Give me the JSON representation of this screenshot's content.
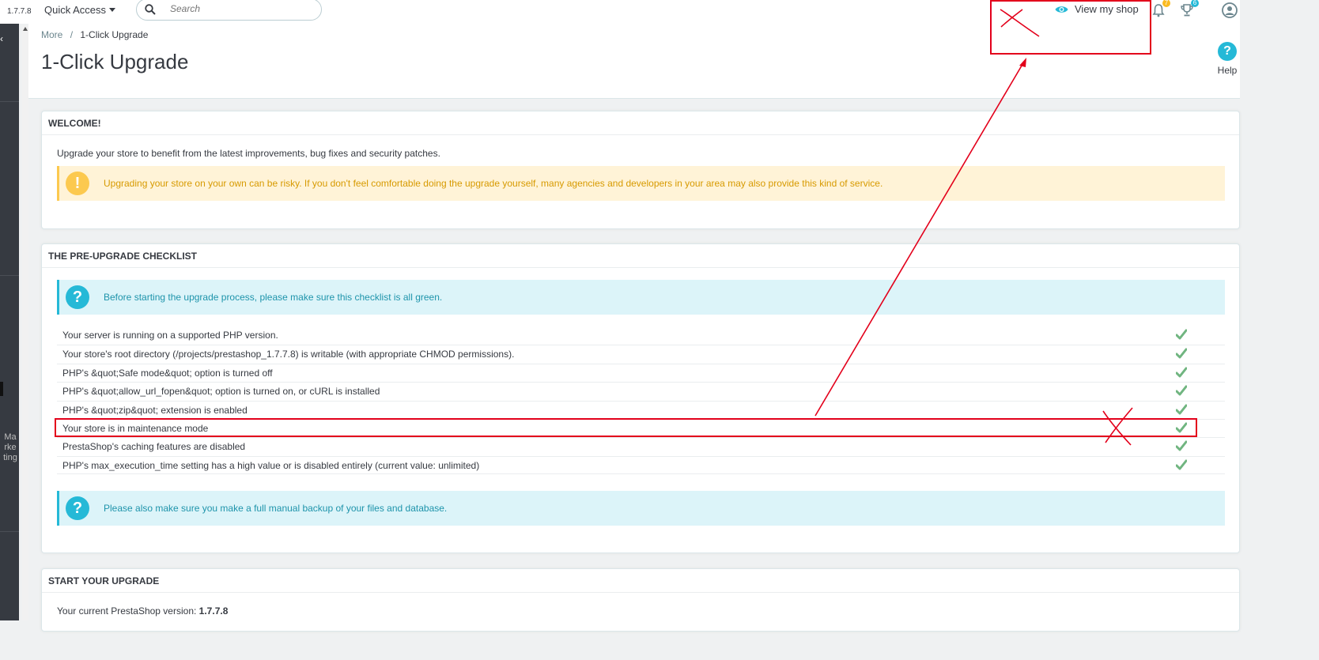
{
  "header": {
    "version": "1.7.7.8",
    "quick_access": "Quick Access",
    "search_placeholder": "Search",
    "view_shop": "View my shop",
    "notif_count": "7",
    "trophy_count": "6"
  },
  "sidebar": {
    "label": "Marketing"
  },
  "breadcrumb": {
    "parent": "More",
    "sep": "/",
    "current": "1-Click Upgrade"
  },
  "page": {
    "title": "1-Click Upgrade",
    "help": "Help"
  },
  "welcome": {
    "heading": "WELCOME!",
    "intro": "Upgrade your store to benefit from the latest improvements, bug fixes and security patches.",
    "warning": "Upgrading your store on your own can be risky. If you don't feel comfortable doing the upgrade yourself, many agencies and developers in your area may also provide this kind of service."
  },
  "checklist": {
    "heading": "THE PRE-UPGRADE CHECKLIST",
    "info": "Before starting the upgrade process, please make sure this checklist is all green.",
    "items": [
      "Your server is running on a supported PHP version.",
      "Your store's root directory (/projects/prestashop_1.7.7.8) is writable (with appropriate CHMOD permissions).",
      "PHP's &quot;Safe mode&quot; option is turned off",
      "PHP's &quot;allow_url_fopen&quot; option is turned on, or cURL is installed",
      "PHP's &quot;zip&quot; extension is enabled",
      "Your store is in maintenance mode",
      "PrestaShop's caching features are disabled",
      "PHP's max_execution_time setting has a high value or is disabled entirely (current value: unlimited)"
    ],
    "backup": "Please also make sure you make a full manual backup of your files and database."
  },
  "start": {
    "heading": "START YOUR UPGRADE",
    "current_label": "Your current PrestaShop version:",
    "current_version": "1.7.7.8"
  },
  "colors": {
    "accent": "#25b9d7",
    "warning": "#fcc94f",
    "success": "#70b580",
    "annotation": "#e3001b"
  }
}
